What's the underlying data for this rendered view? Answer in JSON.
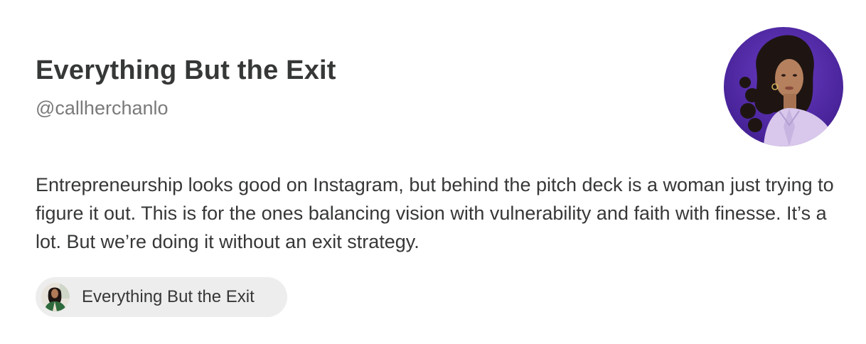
{
  "publication": {
    "title": "Everything But the Exit",
    "handle": "@callherchanlo",
    "description": "Entrepreneurship looks good on Instagram, but behind the pitch deck is a woman just trying to figure it out. This is for the ones balancing vision with vulnerability and faith with finesse. It’s a lot. But we’re doing it without an exit strategy."
  },
  "pill": {
    "label": "Everything But the Exit"
  },
  "colors": {
    "avatar_background": "#5a2fb0",
    "pill_background": "#ededed",
    "text": "#363737",
    "muted_text": "#7a7a7a"
  }
}
